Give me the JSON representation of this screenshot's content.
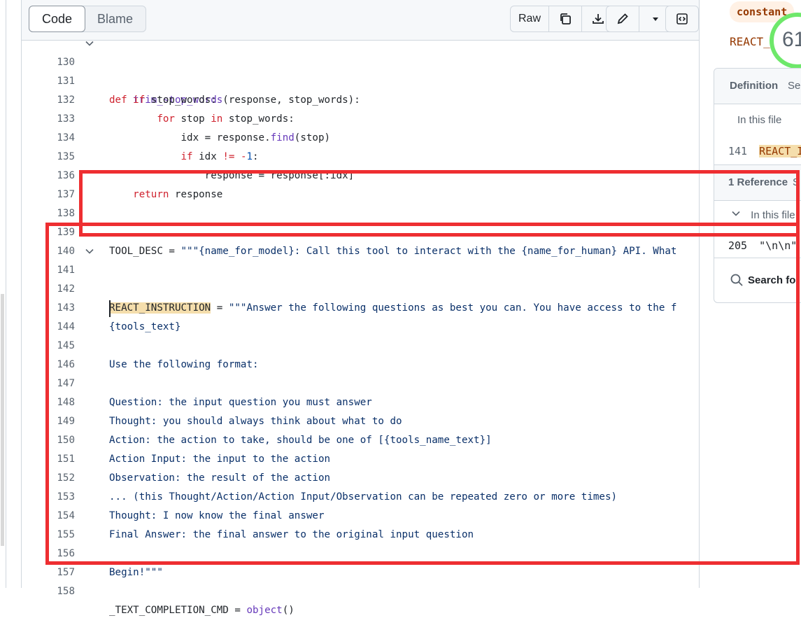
{
  "toolbar": {
    "code_tab": "Code",
    "blame_tab": "Blame",
    "raw_label": "Raw"
  },
  "code_lines": [
    {
      "n": "130",
      "t": "def trim_stop_words(response, stop_words):"
    },
    {
      "n": "131",
      "t": "    if stop_words:"
    },
    {
      "n": "132",
      "t": "        for stop in stop_words:"
    },
    {
      "n": "133",
      "t": "            idx = response.find(stop)"
    },
    {
      "n": "134",
      "t": "            if idx != -1:"
    },
    {
      "n": "135",
      "t": "                response = response[:idx]"
    },
    {
      "n": "136",
      "t": "    return response"
    },
    {
      "n": "137",
      "t": ""
    },
    {
      "n": "138",
      "t": ""
    },
    {
      "n": "139",
      "t": "TOOL_DESC = \"\"\"{name_for_model}: Call this tool to interact with the {name_for_human} API. What"
    },
    {
      "n": "140",
      "t": ""
    },
    {
      "n": "141",
      "t": "REACT_INSTRUCTION = \"\"\"Answer the following questions as best you can. You have access to the f"
    },
    {
      "n": "142",
      "t": ""
    },
    {
      "n": "143",
      "t": "{tools_text}"
    },
    {
      "n": "144",
      "t": ""
    },
    {
      "n": "145",
      "t": "Use the following format:"
    },
    {
      "n": "146",
      "t": ""
    },
    {
      "n": "147",
      "t": "Question: the input question you must answer"
    },
    {
      "n": "148",
      "t": "Thought: you should always think about what to do"
    },
    {
      "n": "149",
      "t": "Action: the action to take, should be one of [{tools_name_text}]"
    },
    {
      "n": "150",
      "t": "Action Input: the input to the action"
    },
    {
      "n": "151",
      "t": "Observation: the result of the action"
    },
    {
      "n": "152",
      "t": "... (this Thought/Action/Action Input/Observation can be repeated zero or more times)"
    },
    {
      "n": "153",
      "t": "Thought: I now know the final answer"
    },
    {
      "n": "154",
      "t": "Final Answer: the final answer to the original input question"
    },
    {
      "n": "155",
      "t": ""
    },
    {
      "n": "156",
      "t": "Begin!\"\"\""
    },
    {
      "n": "157",
      "t": ""
    },
    {
      "n": "158",
      "t": "_TEXT_COMPLETION_CMD = object()"
    }
  ],
  "side": {
    "badge": "constant",
    "symbol": "REACT_",
    "ring_value": "61",
    "definition_label": "Definition",
    "definition_more": "Sea",
    "in_this_file": "In this file",
    "def_line": "141",
    "def_symbol": "REACT_II",
    "references_label": "1 Reference",
    "references_more": "S",
    "ref_in_this_file": "In this file",
    "ref_line": "205",
    "ref_text": "\"\\n\\n\"",
    "search_label": "Search fo"
  },
  "colors": {
    "annotation_red": "#ee2e31",
    "highlight": "#f5deac",
    "ring_green": "#6ee86a"
  }
}
